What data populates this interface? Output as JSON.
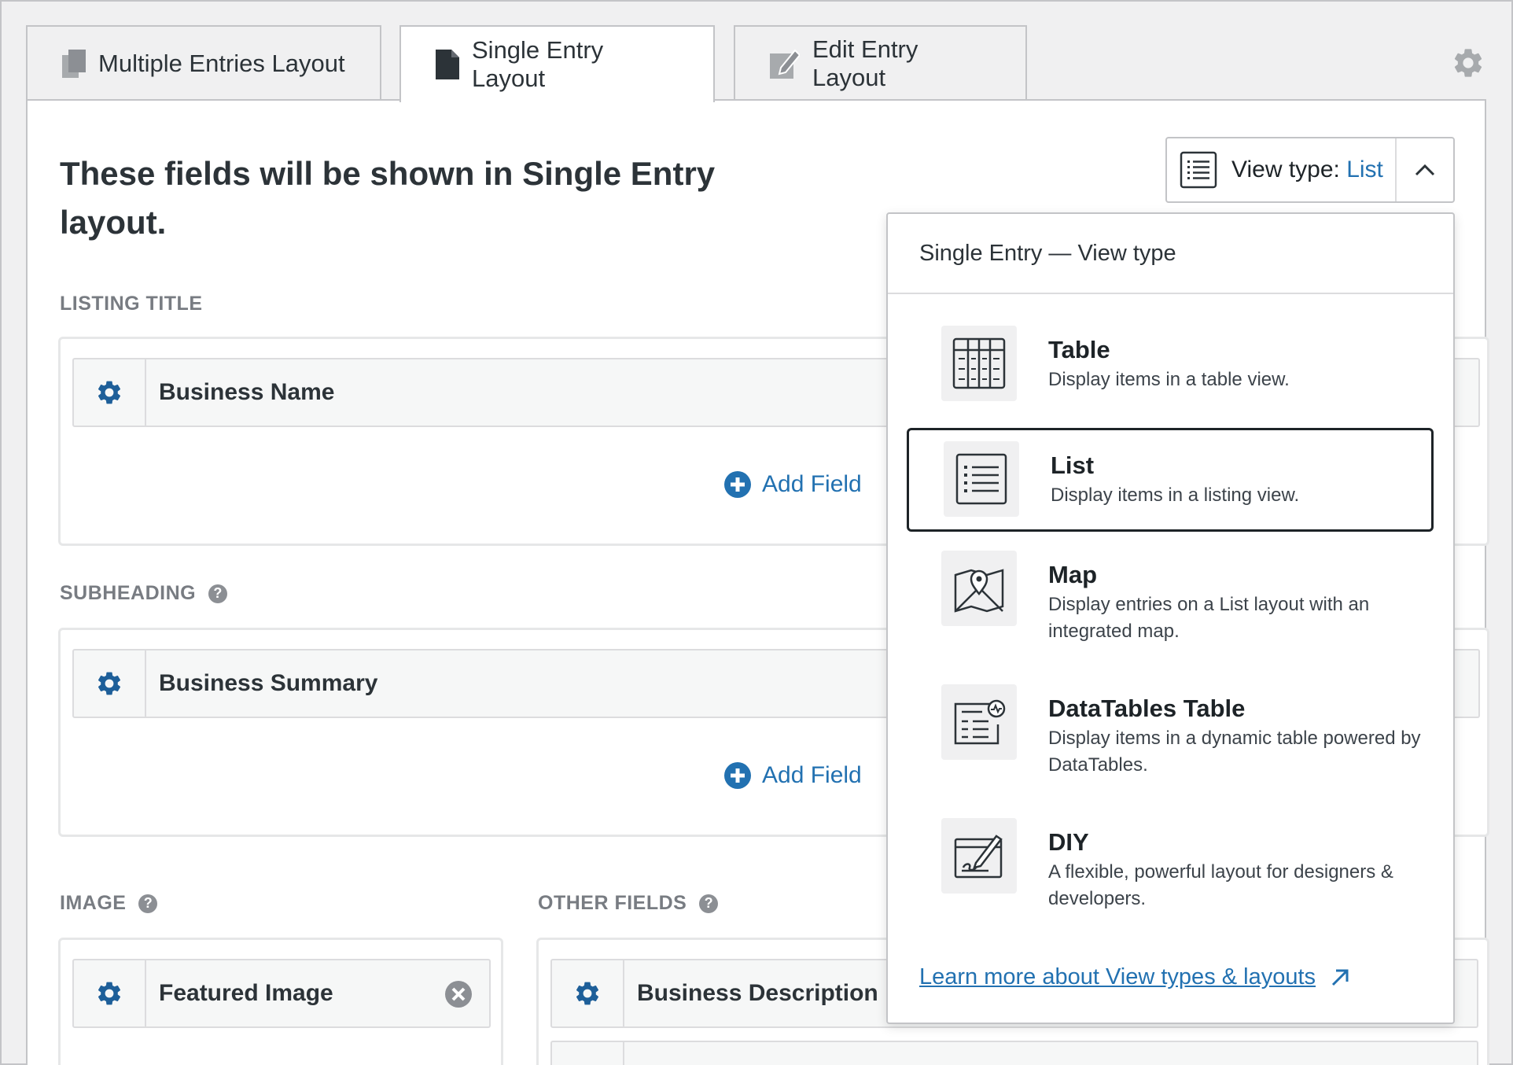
{
  "tabs": [
    {
      "label": "Multiple Entries Layout",
      "icon": "copy-icon",
      "active": false
    },
    {
      "label": "Single Entry Layout",
      "icon": "document-icon",
      "active": true
    },
    {
      "label": "Edit Entry Layout",
      "icon": "edit-icon",
      "active": false
    }
  ],
  "heading": "These fields will be shown in Single Entry layout.",
  "sections": {
    "listing_title": {
      "label": "LISTING TITLE",
      "field": "Business Name",
      "add_label": "Add Field"
    },
    "subheading": {
      "label": "SUBHEADING",
      "help": "?",
      "field": "Business Summary",
      "add_label": "Add Field"
    },
    "image": {
      "label": "IMAGE",
      "help": "?",
      "field": "Featured Image"
    },
    "other_fields": {
      "label": "OTHER FIELDS",
      "help": "?",
      "field": "Business Description"
    }
  },
  "view_type": {
    "prefix": "View type:",
    "value": "List"
  },
  "dropdown": {
    "header": "Single Entry — View type",
    "options": [
      {
        "title": "Table",
        "desc": "Display items in a table view.",
        "icon": "table-icon"
      },
      {
        "title": "List",
        "desc": "Display items in a listing view.",
        "icon": "list-icon",
        "selected": true
      },
      {
        "title": "Map",
        "desc": "Display entries on a List layout with an integrated map.",
        "icon": "map-icon"
      },
      {
        "title": "DataTables Table",
        "desc": "Display items in a dynamic table powered by DataTables.",
        "icon": "datatables-icon"
      },
      {
        "title": "DIY",
        "desc": "A flexible, powerful layout for designers & developers.",
        "icon": "diy-icon"
      }
    ],
    "learn_more": "Learn more about View types & layouts"
  },
  "colors": {
    "accent": "#2271b1",
    "gear": "#1e5f99",
    "text": "#2c3338",
    "muted": "#787c82"
  }
}
